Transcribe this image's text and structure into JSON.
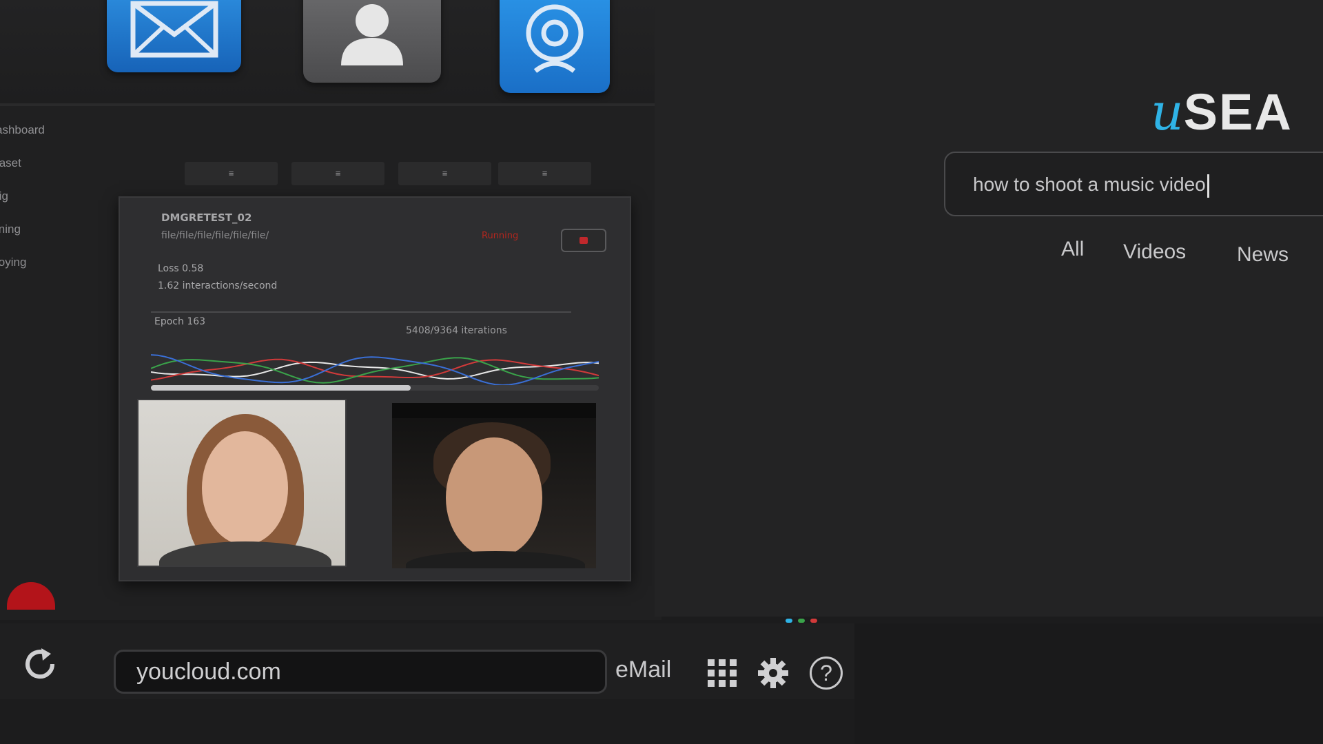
{
  "apps": {
    "mail_label": "",
    "contacts_label": "",
    "camera_label": ""
  },
  "sidebar": {
    "items": [
      {
        "label": "ashboard"
      },
      {
        "label": "taset"
      },
      {
        "label": "fig"
      },
      {
        "label": "ining"
      },
      {
        "label": "loying"
      }
    ]
  },
  "toolbar_pills": [
    "≡",
    "≡",
    "≡",
    "≡"
  ],
  "training_panel": {
    "run_name": "DMGRETEST_02",
    "run_path": "file/file/file/file/file/file/",
    "status": "Running",
    "loss": "Loss 0.58",
    "rate": "1.62 interactions/second",
    "epoch": "Epoch 163",
    "iterations": "5408/9364 iterations",
    "progress": 0.58,
    "series_colors": [
      "#e8e8e8",
      "#d23a3a",
      "#3aa34a",
      "#3a6fd6"
    ]
  },
  "search": {
    "logo_u": "u",
    "logo_rest": "SEA",
    "query": "how to shoot a music video",
    "tabs": [
      "All",
      "Videos",
      "News"
    ]
  },
  "browser_bar": {
    "url": "youcloud.com",
    "email_link": "eMail"
  },
  "colors": {
    "accent_blue": "#2fb3e6",
    "record_red": "#b3141a"
  }
}
